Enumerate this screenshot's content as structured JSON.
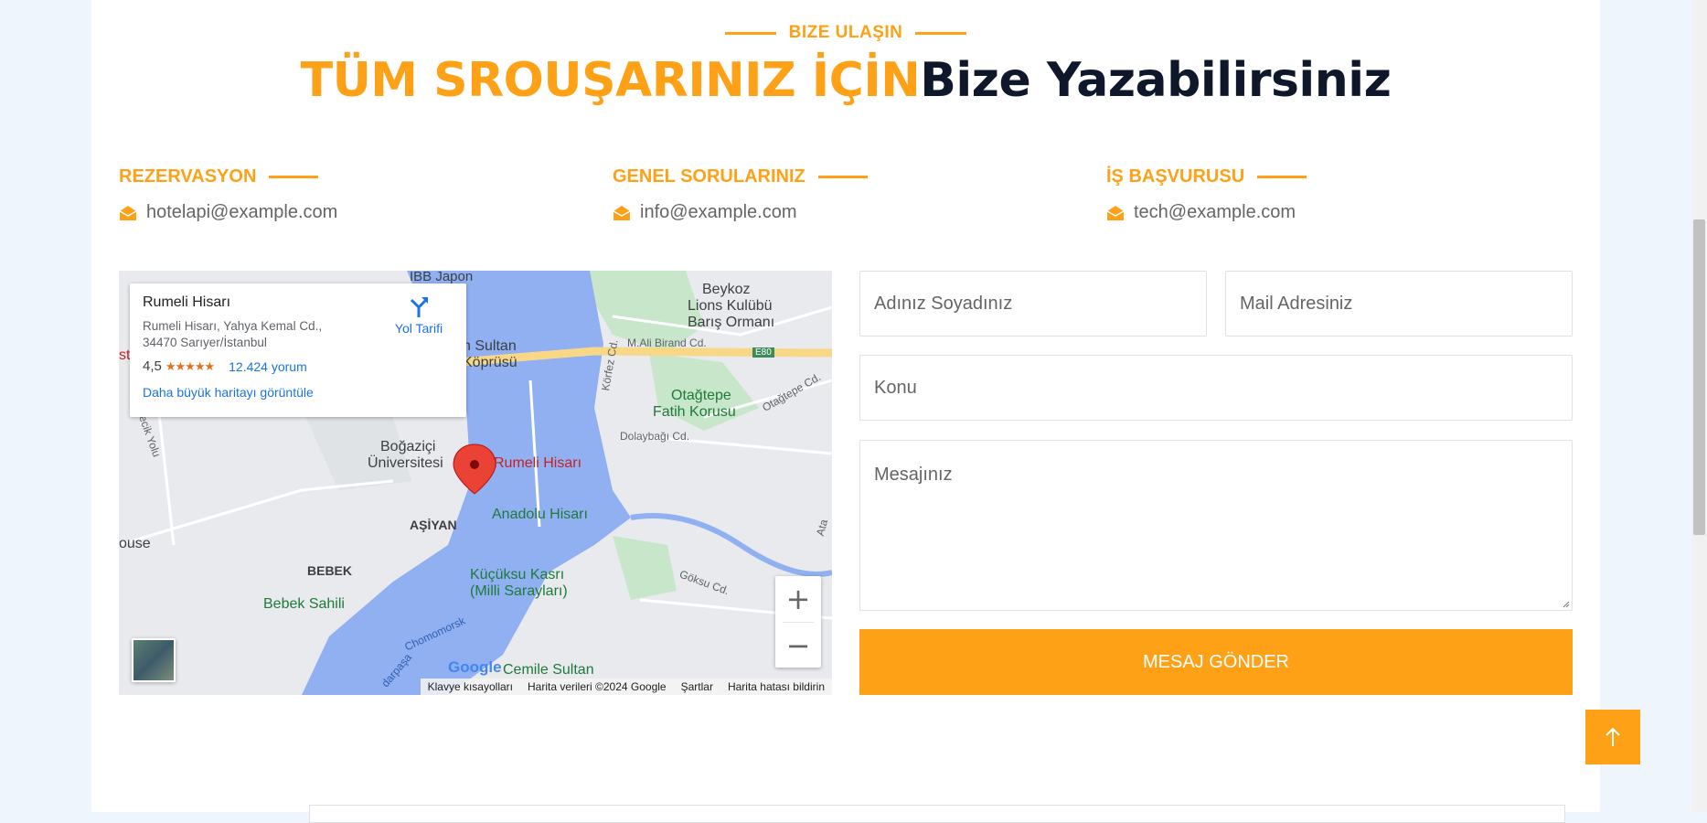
{
  "section": {
    "eyebrow": "BIZE ULAŞIN",
    "headline_accent": "TÜM SROUŞARINIZ İÇİN",
    "headline_dark": "Bize Yazabilirsiniz"
  },
  "contacts": [
    {
      "title": "REZERVASYON",
      "email": "hotelapi@example.com",
      "icon": "envelope-icon"
    },
    {
      "title": "GENEL SORULARINIZ",
      "email": "info@example.com",
      "icon": "envelope-icon"
    },
    {
      "title": "İŞ BAŞVURUSU",
      "email": "tech@example.com",
      "icon": "envelope-icon"
    }
  ],
  "map": {
    "place_name": "Rumeli Hisarı",
    "address": "Rumeli Hisarı, Yahya Kemal Cd., 34470 Sarıyer/İstanbul",
    "rating": "4,5",
    "stars": "★★★★★",
    "reviews": "12.424 yorum",
    "view_larger": "Daha büyük haritayı görüntüle",
    "directions": "Yol Tarifi",
    "marker_label": "Rumeli Hisarı",
    "labels": {
      "ibb": "İBB Japon",
      "beykoz": "Beykoz",
      "lions": "Lions Kulübü",
      "baris": "Barış Ormanı",
      "sultan": "h Sultan",
      "koprusu": "Köprüsü",
      "alibirand": "M.Ali Birand Cd.",
      "e80": "E80",
      "korfez": "Körfez Cd.",
      "otagtepe": "Otağtepe",
      "fatih_korusu": "Fatih Korusu",
      "otagtepe_cd": "Otağtepe Cd.",
      "dolaybagi": "Dolaybağı Cd.",
      "bogazici1": "Boğaziçi",
      "bogazici2": "Üniversitesi",
      "anadolu": "Anadolu Hisarı",
      "asiyan": "AŞİYAN",
      "bebek": "BEBEK",
      "bebek_sahili": "Bebek Sahili",
      "kucuksu1": "Küçüksu Kasrı",
      "kucuksu2": "(Milli Sarayları)",
      "cemile": "Cemile Sultan",
      "goksu": "Göksu Cd.",
      "house": "ouse",
      "st": "st",
      "pecik": "pecik Yolu",
      "chomomorsk": "Chomomorsk",
      "darpasa": "darpaşa",
      "ata": "Ata"
    },
    "google": "Google",
    "footer": [
      "Klavye kısayolları",
      "Harita verileri ©2024 Google",
      "Şartlar",
      "Harita hatası bildirin"
    ],
    "zoom_in": "+",
    "zoom_out": "−"
  },
  "form": {
    "name_placeholder": "Adınız Soyadınız",
    "email_placeholder": "Mail Adresiniz",
    "subject_placeholder": "Konu",
    "message_placeholder": "Mesajınız",
    "submit": "MESAJ GÖNDER"
  },
  "colors": {
    "accent": "#fea116",
    "dark": "#0f172b",
    "text": "#666565"
  }
}
